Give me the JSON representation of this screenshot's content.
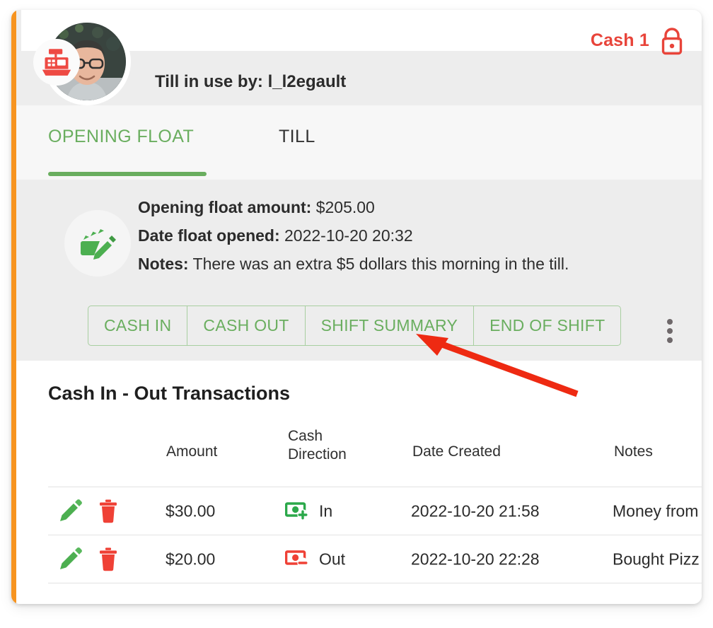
{
  "header": {
    "cash_label": "Cash 1",
    "lock_icon": "lock-icon",
    "register_icon": "cash-register-icon",
    "avatar": "user-avatar",
    "till_in_use": "Till in use by: l_l2egault"
  },
  "tabs": [
    {
      "label": "OPENING FLOAT",
      "active": true
    },
    {
      "label": "TILL",
      "active": false
    }
  ],
  "float_panel": {
    "icon": "money-edit-icon",
    "amount_label": "Opening float amount:",
    "amount_value": "$205.00",
    "date_label": "Date float opened:",
    "date_value": "2022-10-20 20:32",
    "notes_label": "Notes:",
    "notes_value": "There was an extra $5 dollars this morning in the till."
  },
  "actions": {
    "buttons": [
      "CASH IN",
      "CASH OUT",
      "SHIFT SUMMARY",
      "END OF SHIFT"
    ],
    "overflow_icon": "kebab-menu-icon"
  },
  "transactions": {
    "title": "Cash In - Out Transactions",
    "columns": {
      "amount": "Amount",
      "direction": "Cash\nDirection",
      "date": "Date Created",
      "notes": "Notes"
    },
    "rows": [
      {
        "edit_icon": "edit-pencil-icon",
        "delete_icon": "delete-trash-icon",
        "amount": "$30.00",
        "direction": "In",
        "direction_icon": "cash-in-icon",
        "date": "2022-10-20 21:58",
        "notes": "Money from"
      },
      {
        "edit_icon": "edit-pencil-icon",
        "delete_icon": "delete-trash-icon",
        "amount": "$20.00",
        "direction": "Out",
        "direction_icon": "cash-out-icon",
        "date": "2022-10-20 22:28",
        "notes": "Bought Pizz"
      }
    ]
  },
  "annotation": {
    "arrow_icon": "red-pointer-arrow",
    "target": "SHIFT SUMMARY"
  },
  "colors": {
    "accent_orange": "#f79420",
    "brand_green": "#6aae5f",
    "alert_red": "#e8443a",
    "panel_gray": "#ededed",
    "tab_gray": "#f7f7f7"
  }
}
